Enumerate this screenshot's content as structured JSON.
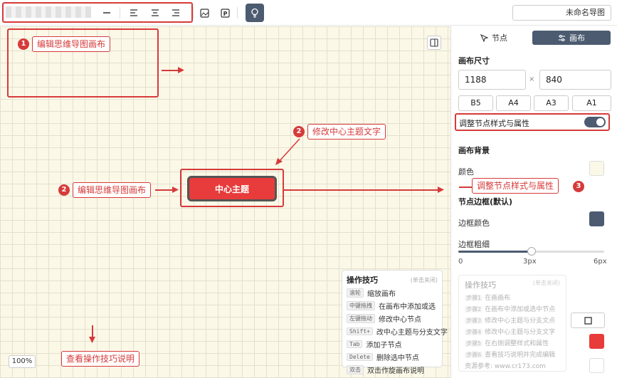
{
  "header": {
    "doc_title": "未命名导图",
    "tool_icons": [
      "minus-icon",
      "align-left-icon",
      "align-center-icon",
      "align-right-icon",
      "image-icon",
      "p-icon",
      "lightbulb-icon"
    ]
  },
  "canvas": {
    "center_node": "中心主题",
    "zoom": "100%",
    "callouts": {
      "c1": "编辑思维导图画布",
      "c2_top": "修改中心主题文字",
      "c2_left": "编辑思维导图画布",
      "c3": "调整节点样式与属性",
      "c4": "查看操作技巧说明"
    },
    "numbers": {
      "n1": "1",
      "n2a": "2",
      "n2b": "2",
      "n3": "3"
    },
    "tips": {
      "title": "操作技巧",
      "hint": "(单击关闭)",
      "rows": [
        {
          "key": "滚轮",
          "text": "缩放画布"
        },
        {
          "key": "中键拖拽",
          "text": "在画布中添加或选"
        },
        {
          "key": "左键拖动",
          "text": "修改中心节点"
        },
        {
          "key": "Shift+",
          "text": "改中心主题与分支文字"
        },
        {
          "key": "Tab",
          "text": "添加子节点"
        },
        {
          "key": "Delete",
          "text": "删除选中节点"
        },
        {
          "key": "双击",
          "text": "双击作旋画布说明"
        }
      ]
    }
  },
  "sidebar": {
    "tabs": {
      "node": "节点",
      "canvas": "画布"
    },
    "canvas_size_title": "画布尺寸",
    "width": "1188",
    "height": "840",
    "times": "×",
    "sizes": [
      "B5",
      "A4",
      "A3",
      "A1"
    ],
    "adjust_row": "调整节点样式与属性",
    "bg_title": "画布背景",
    "color_label": "颜色",
    "border_title": "节点边框(默认)",
    "border_color_label": "边框颜色",
    "border_width_label": "边框粗细",
    "slider_value_fraction": 0.5,
    "slider_ticks": [
      "0",
      "3px",
      "6px"
    ],
    "colors": {
      "bg": "#fbf8e8",
      "border": "#4c5b70",
      "red": "#e83b3b",
      "accent": "#4c5b70"
    },
    "ghost_tips": {
      "title": "操作技巧",
      "hint": "(单击关闭)",
      "rows": [
        {
          "key": "步骤1",
          "text": "在画画布"
        },
        {
          "key": "步骤2",
          "text": "在画布中添加或选中节点"
        },
        {
          "key": "步骤3",
          "text": "修改中心主题与分支文点"
        },
        {
          "key": "步骤4",
          "text": "修改中心主题与分支文字"
        },
        {
          "key": "步骤5",
          "text": "在右侧调整样式和属性"
        },
        {
          "key": "步骤6",
          "text": "查看技巧说明并完成编辑"
        }
      ],
      "footer": "资源参考: www.cr173.com"
    }
  }
}
